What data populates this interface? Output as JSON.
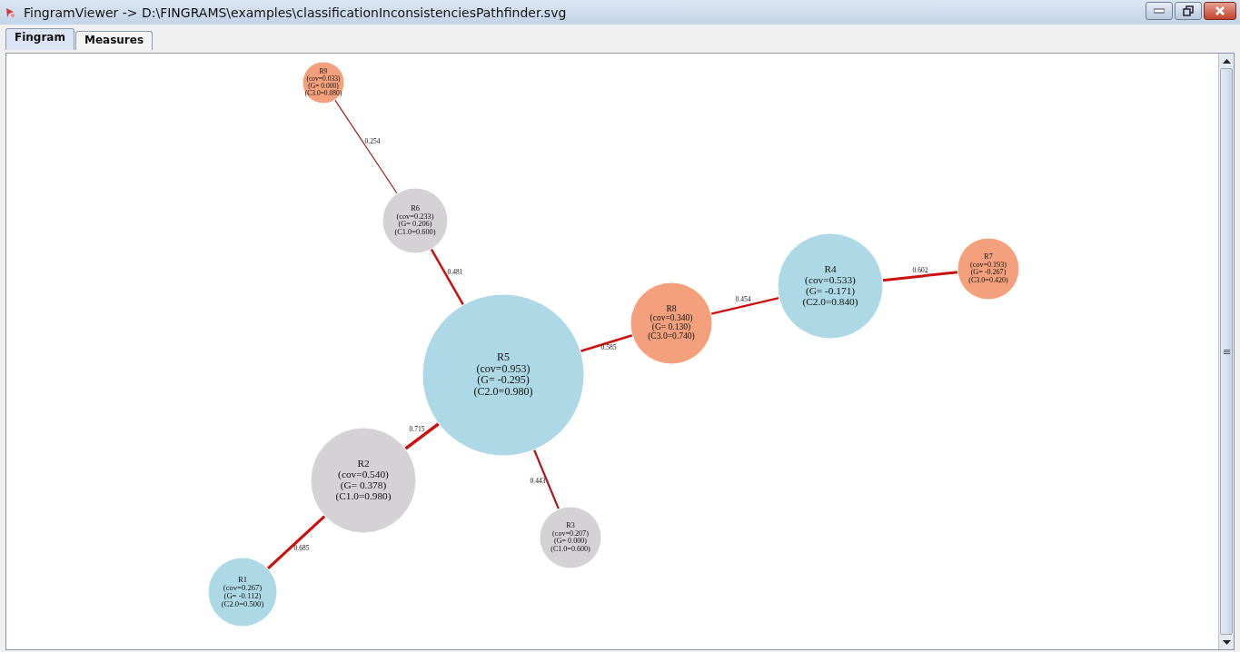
{
  "window": {
    "title": "FingramViewer -> D:\\FINGRAMS\\examples\\classificationInconsistenciesPathfinder.svg"
  },
  "tabs": [
    {
      "label": "Fingram",
      "selected": true
    },
    {
      "label": "Measures",
      "selected": false
    }
  ],
  "nodes": [
    {
      "name": "R9",
      "coverage": "(cov=0.033)",
      "goodness": "(G= 0.000)",
      "class": "(C3.0=0.080)",
      "color": "#f4a07c"
    },
    {
      "name": "R6",
      "coverage": "(cov=0.233)",
      "goodness": "(G= 0.206)",
      "class": "(C1.0=0.600)",
      "color": "#d4d2d4"
    },
    {
      "name": "R5",
      "coverage": "(cov=0.953)",
      "goodness": "(G= -0.295)",
      "class": "(C2.0=0.980)",
      "color": "#add8e6"
    },
    {
      "name": "R8",
      "coverage": "(cov=0.340)",
      "goodness": "(G= 0.130)",
      "class": "(C3.0=0.740)",
      "color": "#f4a07c"
    },
    {
      "name": "R4",
      "coverage": "(cov=0.533)",
      "goodness": "(G= -0.171)",
      "class": "(C2.0=0.840)",
      "color": "#add8e6"
    },
    {
      "name": "R7",
      "coverage": "(cov=0.193)",
      "goodness": "(G= -0.267)",
      "class": "(C3.0=0.420)",
      "color": "#f4a07c"
    },
    {
      "name": "R2",
      "coverage": "(cov=0.540)",
      "goodness": "(G= 0.378)",
      "class": "(C1.0=0.980)",
      "color": "#d4d2d4"
    },
    {
      "name": "R3",
      "coverage": "(cov=0.207)",
      "goodness": "(G= 0.000)",
      "class": "(C1.0=0.600)",
      "color": "#d4d2d4"
    },
    {
      "name": "R1",
      "coverage": "(cov=0.267)",
      "goodness": "(G= -0.112)",
      "class": "(C2.0=0.500)",
      "color": "#add8e6"
    }
  ],
  "edges": [
    {
      "weight": "0.254"
    },
    {
      "weight": "0.481"
    },
    {
      "weight": "0.585"
    },
    {
      "weight": "0.454"
    },
    {
      "weight": "0.602"
    },
    {
      "weight": "0.715"
    },
    {
      "weight": "0.685"
    },
    {
      "weight": "0.443"
    }
  ]
}
